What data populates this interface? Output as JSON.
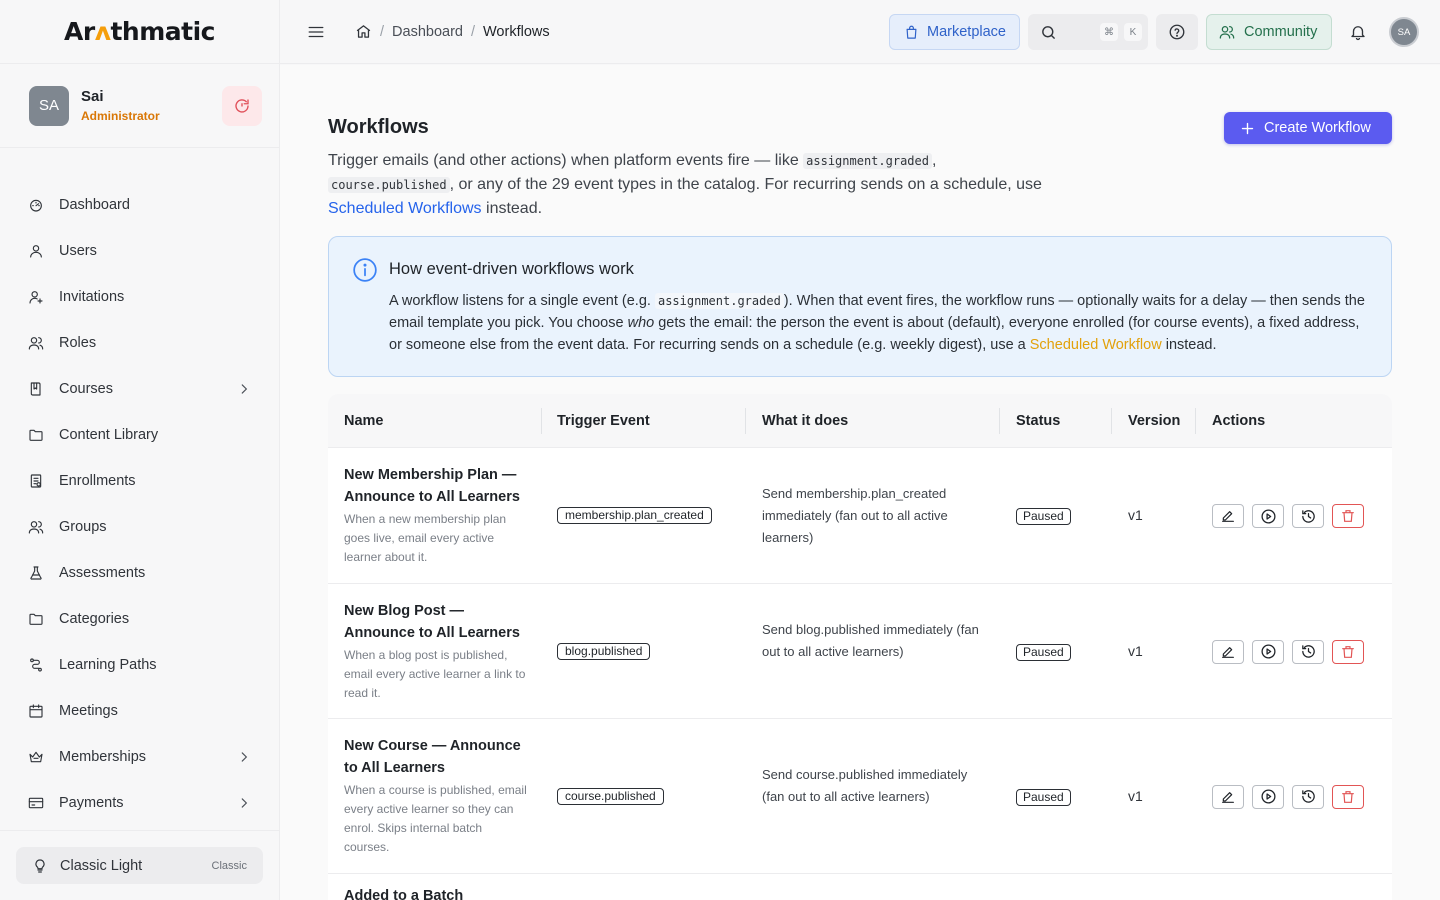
{
  "brand": {
    "pre": "Ar",
    "accent": "ʌ",
    "post": "thmatic"
  },
  "profile": {
    "initials": "SA",
    "name": "Sai",
    "role": "Administrator"
  },
  "nav": [
    {
      "label": "Dashboard",
      "icon": "dashboard-icon"
    },
    {
      "label": "Users",
      "icon": "user-icon"
    },
    {
      "label": "Invitations",
      "icon": "user-plus-icon"
    },
    {
      "label": "Roles",
      "icon": "users-icon"
    },
    {
      "label": "Courses",
      "icon": "book-icon",
      "expandable": true
    },
    {
      "label": "Content Library",
      "icon": "folder-icon"
    },
    {
      "label": "Enrollments",
      "icon": "clipboard-icon"
    },
    {
      "label": "Groups",
      "icon": "users-icon"
    },
    {
      "label": "Assessments",
      "icon": "flask-icon"
    },
    {
      "label": "Categories",
      "icon": "folder-icon"
    },
    {
      "label": "Learning Paths",
      "icon": "route-icon"
    },
    {
      "label": "Meetings",
      "icon": "calendar-icon"
    },
    {
      "label": "Memberships",
      "icon": "crown-icon",
      "expandable": true
    },
    {
      "label": "Payments",
      "icon": "credit-card-icon",
      "expandable": true
    }
  ],
  "theme": {
    "label": "Classic Light",
    "tag": "Classic"
  },
  "topbar": {
    "breadcrumb": [
      "Dashboard",
      "Workflows"
    ],
    "marketplace": "Marketplace",
    "search_keys": [
      "⌘",
      "K"
    ],
    "community": "Community",
    "avatar": "SA"
  },
  "page": {
    "title": "Workflows",
    "create_label": "Create Workflow",
    "intro_a": "Trigger emails (and other actions) when platform events fire — like ",
    "intro_code1": "assignment.graded",
    "intro_b": ",",
    "intro_code2": "course.published",
    "intro_c": ", or any of the 29 event types in the catalog. For recurring sends on a schedule, use ",
    "intro_link": "Scheduled Workflows",
    "intro_d": " instead."
  },
  "info": {
    "title": "How event-driven workflows work",
    "p1": "A workflow listens for a single event (e.g. ",
    "code": "assignment.graded",
    "p2": "). When that event fires, the workflow runs — optionally waits for a delay — then sends the email template you pick. You choose ",
    "em": "who",
    "p3": " gets the email: the person the event is about (default), everyone enrolled (for course events), a fixed address, or someone else from the event data. For recurring sends on a schedule (e.g. weekly digest), use a ",
    "link": "Scheduled Workflow",
    "p4": " instead."
  },
  "table": {
    "columns": [
      "Name",
      "Trigger Event",
      "What it does",
      "Status",
      "Version",
      "Actions"
    ],
    "rows": [
      {
        "name": "New Membership Plan — Announce to All Learners",
        "desc": "When a new membership plan goes live, email every active learner about it.",
        "trigger": "membership.plan_created",
        "what": "Send membership.plan_created immediately (fan out to all active learners)",
        "status": "Paused",
        "version": "v1"
      },
      {
        "name": "New Blog Post — Announce to All Learners",
        "desc": "When a blog post is published, email every active learner a link to read it.",
        "trigger": "blog.published",
        "what": "Send blog.published immediately (fan out to all active learners)",
        "status": "Paused",
        "version": "v1"
      },
      {
        "name": "New Course — Announce to All Learners",
        "desc": "When a course is published, email every active learner so they can enrol. Skips internal batch courses.",
        "trigger": "course.published",
        "what": "Send course.published immediately (fan out to all active learners)",
        "status": "Paused",
        "version": "v1"
      }
    ],
    "partial_row": "Added to a Batch"
  },
  "colors": {
    "primary": "#5b5bf0",
    "link": "#2563eb",
    "warning": "#d97706",
    "danger": "#e25555"
  }
}
